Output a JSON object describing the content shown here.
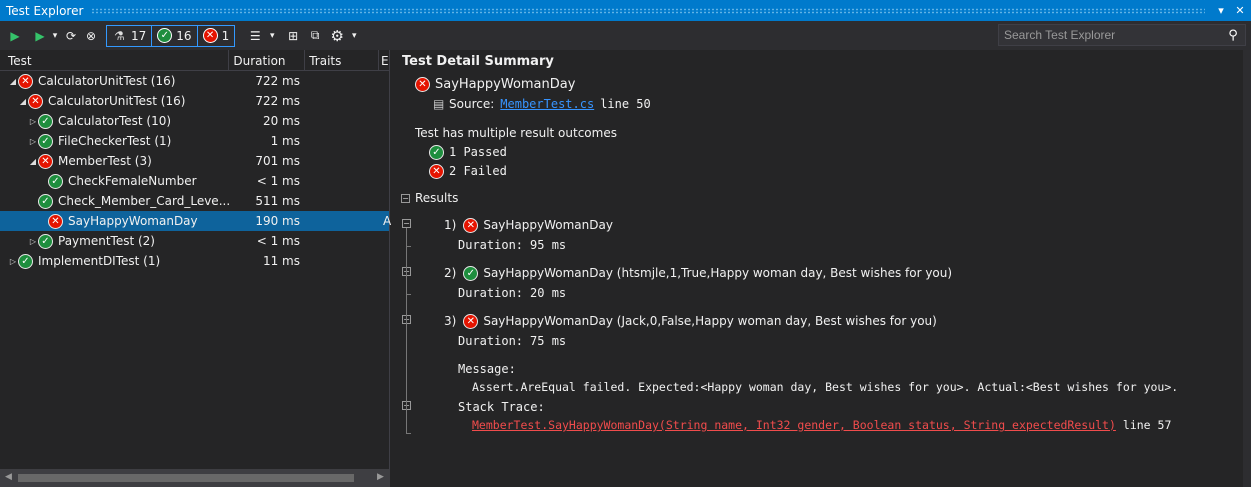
{
  "window": {
    "title": "Test Explorer",
    "pin_glyph": "▾",
    "close_glyph": "✕"
  },
  "toolbar": {
    "run_all_glyph": "▶",
    "run_glyph": "▶",
    "dropdown_glyph": "▾",
    "repeat_glyph": "⟳",
    "cancel_glyph": "⊗",
    "total_count": "17",
    "passed_count": "16",
    "failed_count": "1",
    "playlist_glyph": "☰",
    "group_glyph": "⊞",
    "copy_glyph": "⧉",
    "settings_glyph": "⚙",
    "pass_glyph": "✓",
    "fail_glyph": "✕",
    "flask_glyph": "⚗"
  },
  "search": {
    "placeholder": "Search Test Explorer",
    "icon_glyph": "⚲"
  },
  "columns": {
    "test": "Test",
    "duration": "Duration",
    "traits": "Traits",
    "extra": "E"
  },
  "tree": [
    {
      "name": "CalculatorUnitTest (16)",
      "duration": "722 ms",
      "status": "fail",
      "level": 0,
      "arrow": "◢",
      "selected": false,
      "extra": ""
    },
    {
      "name": "CalculatorUnitTest (16)",
      "duration": "722 ms",
      "status": "fail",
      "level": 1,
      "arrow": "◢",
      "selected": false,
      "extra": ""
    },
    {
      "name": "CalculatorTest (10)",
      "duration": "20 ms",
      "status": "pass",
      "level": 2,
      "arrow": "▷",
      "selected": false,
      "extra": ""
    },
    {
      "name": "FileCheckerTest (1)",
      "duration": "1 ms",
      "status": "pass",
      "level": 2,
      "arrow": "▷",
      "selected": false,
      "extra": ""
    },
    {
      "name": "MemberTest (3)",
      "duration": "701 ms",
      "status": "fail",
      "level": 2,
      "arrow": "◢",
      "selected": false,
      "extra": ""
    },
    {
      "name": "CheckFemaleNumber",
      "duration": "< 1 ms",
      "status": "pass",
      "level": 3,
      "arrow": "",
      "selected": false,
      "extra": ""
    },
    {
      "name": "Check_Member_Card_Leve...",
      "duration": "511 ms",
      "status": "pass",
      "level": 3,
      "arrow": "",
      "selected": false,
      "extra": ""
    },
    {
      "name": "SayHappyWomanDay",
      "duration": "190 ms",
      "status": "fail",
      "level": 3,
      "arrow": "",
      "selected": true,
      "extra": "A"
    },
    {
      "name": "PaymentTest (2)",
      "duration": "< 1 ms",
      "status": "pass",
      "level": 2,
      "arrow": "▷",
      "selected": false,
      "extra": ""
    },
    {
      "name": "ImplementDITest (1)",
      "duration": "11 ms",
      "status": "pass",
      "level": 0,
      "arrow": "▷",
      "selected": false,
      "extra": ""
    }
  ],
  "detail": {
    "header": "Test Detail Summary",
    "test_name": "SayHappyWomanDay",
    "source_label": "Source:",
    "source_file": "MemberTest.cs",
    "source_line": "line 50",
    "outcomes_title": "Test has multiple result outcomes",
    "passed_text": "1 Passed",
    "failed_text": "2 Failed",
    "results_label": "Results",
    "collapse_glyph": "⊟",
    "results": [
      {
        "index": "1)",
        "status": "fail",
        "name": "SayHappyWomanDay",
        "duration_label": "Duration:",
        "duration": "95 ms"
      },
      {
        "index": "2)",
        "status": "pass",
        "name": "SayHappyWomanDay (htsmjle,1,True,Happy woman day, Best wishes for you)",
        "duration_label": "Duration:",
        "duration": "20 ms"
      },
      {
        "index": "3)",
        "status": "fail",
        "name": "SayHappyWomanDay (Jack,0,False,Happy woman day, Best wishes for you)",
        "duration_label": "Duration:",
        "duration": "75 ms"
      }
    ],
    "message_label": "Message:",
    "message": "Assert.AreEqual failed. Expected:<Happy woman day, Best wishes for you>. Actual:<Best wishes for you>.",
    "stack_label": "Stack Trace:",
    "stack_link": "MemberTest.SayHappyWomanDay(String name, Int32 gender, Boolean status, String expectedResult)",
    "stack_line": "line 57"
  },
  "colors": {
    "accent": "#007acc",
    "pass": "#1e8e3e",
    "fail": "#e51400",
    "selection": "#0e639c",
    "link": "#3794ff"
  }
}
